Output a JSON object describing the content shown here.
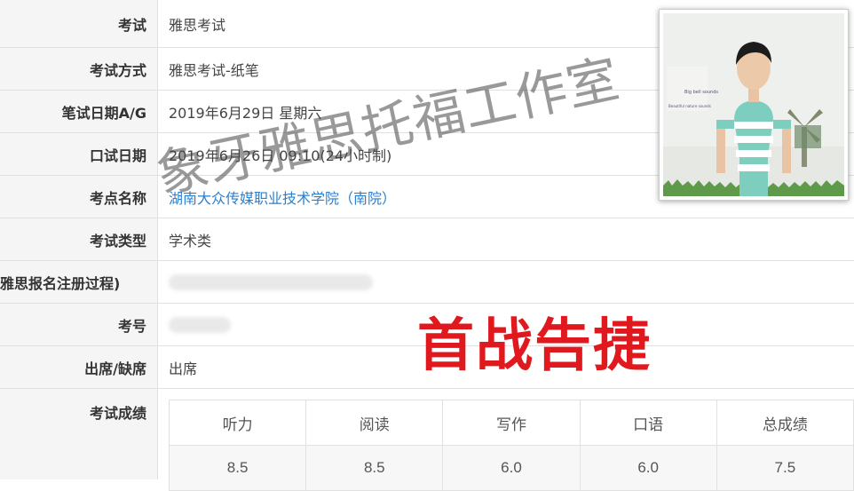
{
  "rows": [
    {
      "label": "考试",
      "value": "雅思考试"
    },
    {
      "label": "考试方式",
      "value": "雅思考试-纸笔"
    },
    {
      "label": "笔试日期A/G",
      "value": "2019年6月29日 星期六"
    },
    {
      "label": "口试日期",
      "value": "2019年6月26日 09:10(24小时制)"
    },
    {
      "label": "考点名称",
      "value": "湖南大众传媒职业技术学院（南院）"
    },
    {
      "label": "考试类型",
      "value": "学术类"
    },
    {
      "label": "雅思报名注册过程)",
      "value": ""
    },
    {
      "label": "考号",
      "value": ""
    },
    {
      "label": "出席/缺席",
      "value": "出席"
    },
    {
      "label": "考试成绩",
      "value": ""
    }
  ],
  "scores": {
    "headers": [
      "听力",
      "阅读",
      "写作",
      "口语",
      "总成绩"
    ],
    "values": [
      "8.5",
      "8.5",
      "6.0",
      "6.0",
      "7.5"
    ]
  },
  "photo": {
    "board_text_1": "Big bell sounds",
    "board_text_2": "Beautiful nature sounds"
  },
  "watermark": "象牙雅思托福工作室",
  "headline": "首战告捷",
  "colors": {
    "link": "#2a7fcf",
    "headline": "#e0191f",
    "label_bg": "#f5f5f5"
  }
}
